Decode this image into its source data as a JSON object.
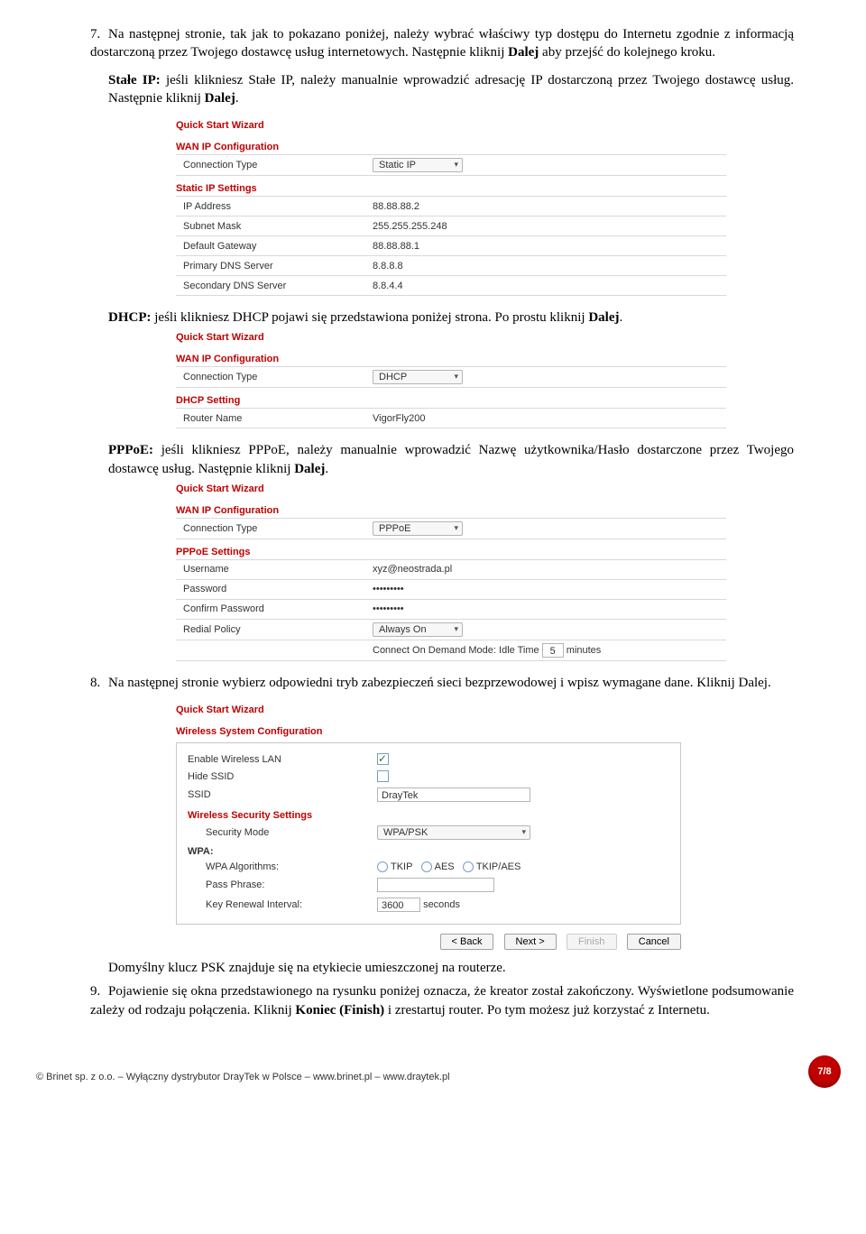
{
  "step7": {
    "num": "7.",
    "text_a": "Na następnej stronie, tak jak to pokazano poniżej, należy wybrać właściwy typ dostępu do Internetu zgodnie z informacją dostarczoną przez Twojego dostawcę usług internetowych. Następnie kliknij ",
    "bold_a": "Dalej",
    "text_b": " aby przejść do kolejnego kroku.",
    "static_ip_label": "Stałe IP:",
    "static_ip_text_a": " jeśli klikniesz Stałe IP, należy manualnie wprowadzić adresację IP dostarczoną przez Twojego dostawcę usług. Następnie kliknij ",
    "static_ip_bold": "Dalej",
    "static_ip_text_b": "."
  },
  "wiz_static": {
    "title": "Quick Start Wizard",
    "section1": "WAN IP Configuration",
    "conn_type_label": "Connection Type",
    "conn_type_value": "Static IP",
    "section2": "Static IP Settings",
    "rows": [
      {
        "label": "IP Address",
        "value": "88.88.88.2"
      },
      {
        "label": "Subnet Mask",
        "value": "255.255.255.248"
      },
      {
        "label": "Default Gateway",
        "value": "88.88.88.1"
      },
      {
        "label": "Primary DNS Server",
        "value": "8.8.8.8"
      },
      {
        "label": "Secondary DNS Server",
        "value": "8.8.4.4"
      }
    ]
  },
  "dhcp_para": {
    "bold": "DHCP:",
    "text_a": " jeśli klikniesz DHCP pojawi się przedstawiona poniżej strona. Po prostu kliknij ",
    "bold_b": "Dalej",
    "text_b": "."
  },
  "wiz_dhcp": {
    "title": "Quick Start Wizard",
    "section1": "WAN IP Configuration",
    "conn_type_label": "Connection Type",
    "conn_type_value": "DHCP",
    "section2": "DHCP Setting",
    "router_label": "Router Name",
    "router_value": "VigorFly200"
  },
  "pppoe_para": {
    "bold": "PPPoE:",
    "text_a": " jeśli klikniesz PPPoE, należy manualnie wprowadzić Nazwę użytkownika/Hasło dostarczone przez Twojego dostawcę usług. Następnie kliknij ",
    "bold_b": "Dalej",
    "text_b": "."
  },
  "wiz_pppoe": {
    "title": "Quick Start Wizard",
    "section1": "WAN IP Configuration",
    "conn_type_label": "Connection Type",
    "conn_type_value": "PPPoE",
    "section2": "PPPoE Settings",
    "rows": [
      {
        "label": "Username",
        "value": "xyz@neostrada.pl"
      },
      {
        "label": "Password",
        "value": "•••••••••"
      },
      {
        "label": "Confirm Password",
        "value": "•••••••••"
      }
    ],
    "redial_label": "Redial Policy",
    "redial_value": "Always On",
    "idle_prefix": "Connect On Demand Mode: Idle Time",
    "idle_value": "5",
    "idle_suffix": "minutes"
  },
  "step8": {
    "num": "8.",
    "text": "Na następnej stronie wybierz odpowiedni tryb zabezpieczeń sieci bezprzewodowej i wpisz wymagane dane. Kliknij Dalej."
  },
  "wiz_wls": {
    "title": "Quick Start Wizard",
    "section": "Wireless System Configuration",
    "enable_label": "Enable Wireless LAN",
    "hide_label": "Hide SSID",
    "ssid_label": "SSID",
    "ssid_value": "DrayTek",
    "sec_section": "Wireless Security Settings",
    "mode_label": "Security Mode",
    "mode_value": "WPA/PSK",
    "wpa_label": "WPA:",
    "algo_label": "WPA Algorithms:",
    "algo_tkip": "TKIP",
    "algo_aes": "AES",
    "algo_both": "TKIP/AES",
    "pass_label": "Pass Phrase:",
    "key_label": "Key Renewal Interval:",
    "key_value": "3600",
    "key_unit": "seconds"
  },
  "buttons": {
    "back": "< Back",
    "next": "Next >",
    "finish": "Finish",
    "cancel": "Cancel"
  },
  "psk_note": "Domyślny klucz PSK znajduje się na etykiecie umieszczonej na routerze.",
  "step9": {
    "num": "9.",
    "text_a": "Pojawienie się okna przedstawionego na rysunku poniżej oznacza, że kreator został zakończony. Wyświetlone podsumowanie zależy od rodzaju połączenia. Kliknij ",
    "bold_a": "Koniec (Finish)",
    "text_b": " i zrestartuj router. Po tym możesz już korzystać z Internetu."
  },
  "footer": {
    "text": "© Brinet sp. z o.o. – Wyłączny dystrybutor DrayTek w Polsce – www.brinet.pl – www.draytek.pl",
    "page": "7/8"
  }
}
